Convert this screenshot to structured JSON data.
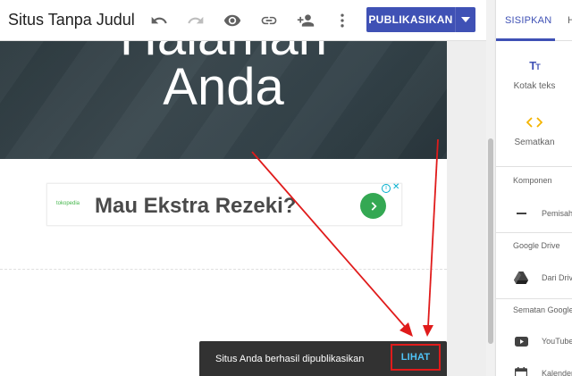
{
  "topbar": {
    "site_title": "Situs Tanpa Judul",
    "publish_label": "PUBLIKASIKAN"
  },
  "canvas": {
    "hero_line1": "Halaman",
    "hero_line2": "Anda",
    "ad": {
      "logo_text": "tokopedia",
      "headline": "Mau Ekstra Rezeki?"
    }
  },
  "panel": {
    "tabs": [
      "SISIPKAN",
      "H"
    ],
    "tools": [
      {
        "label": "Kotak teks",
        "icon": "text-box-icon"
      },
      {
        "label": "Sematkan",
        "icon": "embed-icon"
      }
    ],
    "sections": [
      {
        "heading": "Komponen",
        "items": [
          {
            "label": "Pemisah",
            "icon": "divider-icon"
          }
        ]
      },
      {
        "heading": "Google Drive",
        "items": [
          {
            "label": "Dari Drive",
            "icon": "drive-icon"
          }
        ]
      },
      {
        "heading": "Sematan Google",
        "items": [
          {
            "label": "YouTube",
            "icon": "youtube-icon"
          },
          {
            "label": "Kalender",
            "icon": "calendar-icon"
          }
        ]
      }
    ]
  },
  "toast": {
    "message": "Situs Anda berhasil dipublikasikan",
    "action": "LIHAT"
  },
  "colors": {
    "accent": "#3f51b5",
    "toast_bg": "#323232",
    "toast_action": "#4fc3f7",
    "annotation": "#e01b1b"
  }
}
